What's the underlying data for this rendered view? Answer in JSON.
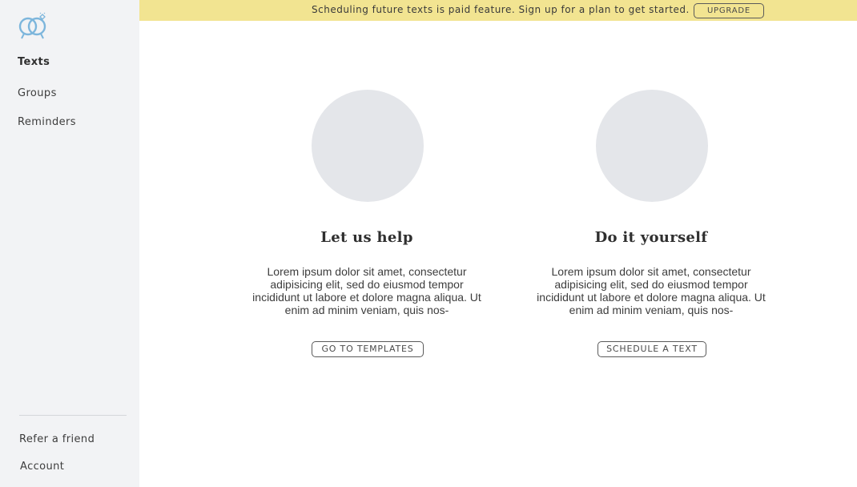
{
  "banner": {
    "message": "Scheduling future texts is paid feature. Sign up for a plan to get started.",
    "upgrade_label": "UPGRADE",
    "color": "#f2e491"
  },
  "sidebar": {
    "logo_icon": "linked-rings-icon",
    "items": [
      {
        "label": "Texts",
        "active": true
      },
      {
        "label": "Groups",
        "active": false
      },
      {
        "label": "Reminders",
        "active": false
      }
    ],
    "footer_items": [
      {
        "label": "Refer a friend"
      },
      {
        "label": "Account"
      }
    ]
  },
  "cards": [
    {
      "title": "Let us help",
      "body": "Lorem ipsum dolor sit amet, consectetur adipisicing elit, sed do eiusmod tempor incididunt ut labore et dolore magna aliqua. Ut enim ad minim veniam, quis nos-",
      "button_label": "GO TO TEMPLATES"
    },
    {
      "title": "Do it yourself",
      "body": "Lorem ipsum dolor sit amet, consectetur adipisicing elit, sed do eiusmod tempor incididunt ut labore et dolore magna aliqua. Ut enim ad minim veniam, quis nos-",
      "button_label": "SCHEDULE A TEXT"
    }
  ]
}
